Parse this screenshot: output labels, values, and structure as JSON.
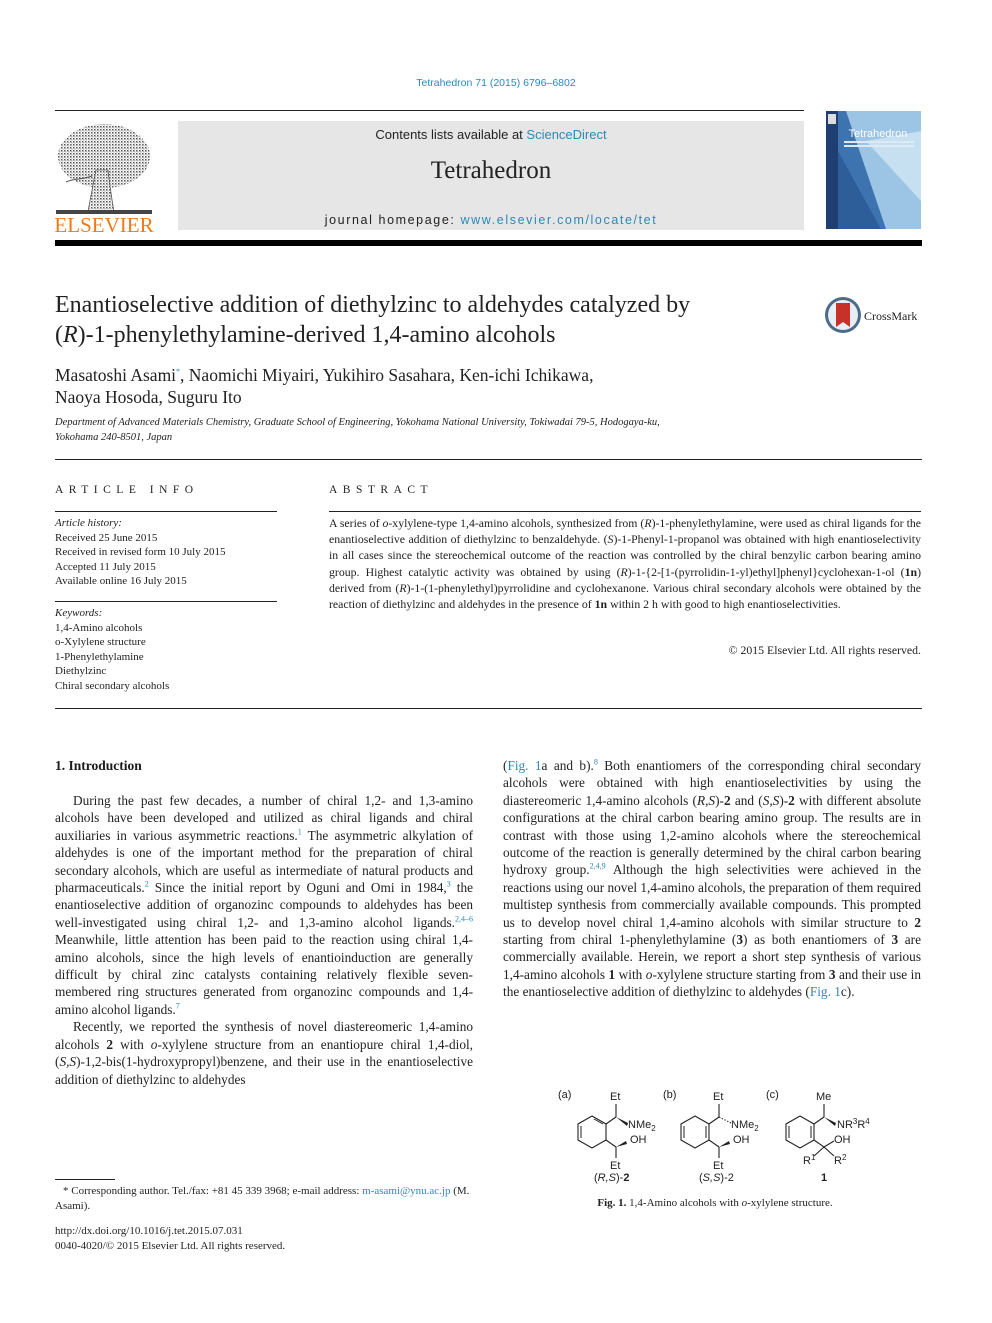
{
  "header": {
    "journal_ref": "Tetrahedron 71 (2015) 6796–6802",
    "contents_prefix": "Contents lists available at ",
    "contents_link": "ScienceDirect",
    "journal_name": "Tetrahedron",
    "homepage_prefix": "journal homepage: ",
    "homepage_link": "www.elsevier.com/locate/tet",
    "publisher_logo_text": "ELSEVIER",
    "cover_title": "Tetrahedron",
    "crossmark_label": "CrossMark",
    "colors": {
      "link": "#2a8ab8",
      "elsevier_orange": "#f07a1a",
      "banner_bg": "#e6e6e6"
    }
  },
  "article": {
    "title_line1": "Enantioselective addition of diethylzinc to aldehydes catalyzed by",
    "title_line2_pre": "(",
    "title_line2_italic": "R",
    "title_line2_post": ")-1-phenylethylamine-derived 1,4-amino alcohols",
    "authors_line1_first": "Masatoshi Asami",
    "authors_star": "*",
    "authors_line1_rest": ", Naomichi Miyairi, Yukihiro Sasahara, Ken-ichi Ichikawa,",
    "authors_line2": "Naoya Hosoda, Suguru Ito",
    "affiliation_line1": "Department of Advanced Materials Chemistry, Graduate School of Engineering, Yokohama National University, Tokiwadai 79-5, Hodogaya-ku,",
    "affiliation_line2": "Yokohama 240-8501, Japan"
  },
  "article_info": {
    "heading": "ARTICLE INFO",
    "history_label": "Article history:",
    "history": [
      "Received 25 June 2015",
      "Received in revised form 10 July 2015",
      "Accepted 11 July 2015",
      "Available online 16 July 2015"
    ],
    "keywords_label": "Keywords:",
    "keywords": [
      "1,4-Amino alcohols",
      "o-Xylylene structure",
      "1-Phenylethylamine",
      "Diethylzinc",
      "Chiral secondary alcohols"
    ]
  },
  "abstract": {
    "heading": "ABSTRACT",
    "text": [
      "A series of ",
      "o",
      "-xylylene-type 1,4-amino alcohols, synthesized from (",
      "R",
      ")-1-phenylethylamine, were used as chiral ligands for the enantioselective addition of diethylzinc to benzaldehyde. (",
      "S",
      ")-1-Phenyl-1-propanol was obtained with high enantioselectivity in all cases since the stereochemical outcome of the reaction was controlled by the chiral benzylic carbon bearing amino group. Highest catalytic activity was obtained by using (",
      "R",
      ")-1-{2-[1-(pyrrolidin-1-yl)ethyl]phenyl}cyclohexan-1-ol (",
      "1n",
      ") derived from (",
      "R",
      ")-1-(1-phenylethyl)pyrrolidine and cyclohexanone. Various chiral secondary alcohols were obtained by the reaction of diethylzinc and aldehydes in the presence of ",
      "1n",
      " within 2 h with good to high enantioselectivities."
    ],
    "copyright": "© 2015 Elsevier Ltd. All rights reserved."
  },
  "intro": {
    "heading": "1.  Introduction",
    "p1": [
      "During the past few decades, a number of chiral 1,2- and 1,3-amino alcohols have been developed and utilized as chiral ligands and chiral auxiliaries in various asymmetric reactions.",
      "1",
      " The asymmetric alkylation of aldehydes is one of the important method for the preparation of chiral secondary alcohols, which are useful as intermediate of natural products and pharmaceuticals.",
      "2",
      " Since the initial report by Oguni and Omi in 1984,",
      "3",
      " the enantioselective addition of organozinc compounds to aldehydes has been well-investigated using chiral 1,2- and 1,3-amino alcohol ligands.",
      "2,4–6",
      " Meanwhile, little attention has been paid to the reaction using chiral 1,4-amino alcohols, since the high levels of enantioinduction are generally difficult by chiral zinc catalysts containing relatively flexible seven-membered ring structures generated from organozinc compounds and 1,4-amino alcohol ligands.",
      "7"
    ],
    "p2_left": [
      "Recently, we reported the synthesis of novel diastereomeric 1,4-amino alcohols ",
      "2",
      " with ",
      "o",
      "-xylylene structure from an enantiopure chiral 1,4-diol, (",
      "S,S",
      ")-1,2-bis(1-hydroxypropyl)benzene, and their use in the enantioselective addition of diethylzinc to aldehydes"
    ],
    "p2_right": [
      "(",
      "Fig. 1",
      "a and b).",
      "8",
      " Both enantiomers of the corresponding chiral secondary alcohols were obtained with high enantioselectivities by using the diastereomeric 1,4-amino alcohols (",
      "R,S",
      ")-",
      "2",
      " and (",
      "S,S",
      ")-",
      "2",
      " with different absolute configurations at the chiral carbon bearing amino group. The results are in contrast with those using 1,2-amino alcohols where the stereochemical outcome of the reaction is generally determined by the chiral carbon bearing hydroxy group.",
      "2,4,9",
      " Although the high selectivities were achieved in the reactions using our novel 1,4-amino alcohols, the preparation of them required multistep synthesis from commercially available compounds. This prompted us to develop novel chiral 1,4-amino alcohols with similar structure to ",
      "2",
      " starting from chiral 1-phenylethylamine (",
      "3",
      ") as both enantiomers of ",
      "3",
      " are commercially available. Herein, we report a short step synthesis of various 1,4-amino alcohols ",
      "1",
      " with ",
      "o",
      "-xylylene structure starting from ",
      "3",
      " and their use in the enantioselective addition of diethylzinc to aldehydes (",
      "Fig. 1",
      "c)."
    ]
  },
  "figure": {
    "panels": [
      {
        "label": "(a)",
        "top": "Et",
        "amine": "NMe",
        "amine_sub": "2",
        "hydroxyl": "OH",
        "bottom": "Et",
        "compound_pre": "(",
        "compound_config": "R,S",
        "compound_post": ")-",
        "compound_num": "2"
      },
      {
        "label": "(b)",
        "top": "Et",
        "amine": "NMe",
        "amine_sub": "2",
        "hydroxyl": "OH",
        "bottom": "Et",
        "compound_pre": "(",
        "compound_config": "S,S",
        "compound_post": ")-",
        "compound_num": "2"
      },
      {
        "label": "(c)",
        "top": "Me",
        "amine": "NR",
        "amine_sup1": "3",
        "amine_mid": "R",
        "amine_sup2": "4",
        "hydroxyl": "OH",
        "r1": "R",
        "r1_sup": "1",
        "r2": "R",
        "r2_sup": "2",
        "compound_num": "1"
      }
    ],
    "caption_label": "Fig. 1.",
    "caption_text_pre": " 1,4-Amino alcohols with ",
    "caption_italic": "o",
    "caption_text_post": "-xylylene structure."
  },
  "footer": {
    "corresponding_pre": "* Corresponding author. Tel./fax: +81 45 339 3968; e-mail address: ",
    "email": "m-asami@ynu.ac.jp",
    "corresponding_post": " (M. Asami).",
    "doi": "http://dx.doi.org/10.1016/j.tet.2015.07.031",
    "issn_line": "0040-4020/© 2015 Elsevier Ltd. All rights reserved."
  }
}
